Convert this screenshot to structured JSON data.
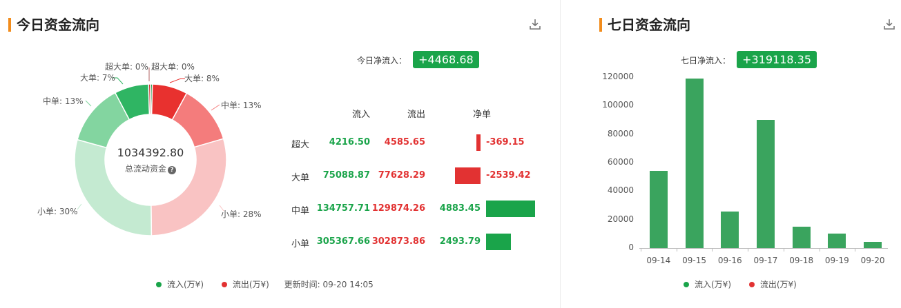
{
  "left": {
    "title": "今日资金流向",
    "net_label": "今日净流入：",
    "net_value": "+4468.68",
    "donut": {
      "total": "1034392.80",
      "total_label": "总流动资金",
      "segments": [
        {
          "label": "超大单: 0%",
          "pct": 0.4,
          "color": "#1f9a4a"
        },
        {
          "label": "大单: 8%",
          "pct": 7.5,
          "color": "#e8312f"
        },
        {
          "label": "中单: 13%",
          "pct": 12.6,
          "color": "#f47c7c"
        },
        {
          "label": "小单: 28%",
          "pct": 29.3,
          "color": "#f9c3c3"
        },
        {
          "label": "小单: 30%",
          "pct": 29.5,
          "color": "#c4ead1"
        },
        {
          "label": "中单: 13%",
          "pct": 13.0,
          "color": "#83d5a0"
        },
        {
          "label": "大单: 7%",
          "pct": 7.3,
          "color": "#2fb563"
        },
        {
          "label": "超大单: 0%",
          "pct": 0.4,
          "color": "#cf2b2b"
        }
      ]
    },
    "table": {
      "headers": [
        "流入",
        "流出",
        "净单"
      ],
      "rows": [
        {
          "name": "超大",
          "in": "4216.50",
          "out": "4585.65",
          "net": "-369.15",
          "net_value": -369.15
        },
        {
          "name": "大单",
          "in": "75088.87",
          "out": "77628.29",
          "net": "-2539.42",
          "net_value": -2539.42
        },
        {
          "name": "中单",
          "in": "134757.71",
          "out": "129874.26",
          "net": "4883.45",
          "net_value": 4883.45
        },
        {
          "name": "小单",
          "in": "305367.66",
          "out": "302873.86",
          "net": "2493.79",
          "net_value": 2493.79
        }
      ]
    },
    "legend": {
      "in": "流入(万¥)",
      "out": "流出(万¥)",
      "updated": "更新时间: 09-20 14:05"
    },
    "colors": {
      "green": "#1aa44a",
      "red": "#e23232",
      "accent": "#f28c1c"
    }
  },
  "right": {
    "title": "七日资金流向",
    "net_label": "七日净流入：",
    "net_value": "+319118.35",
    "legend": {
      "in": "流入(万¥)",
      "out": "流出(万¥)"
    }
  },
  "chart_data": {
    "type": "bar",
    "categories": [
      "09-14",
      "09-15",
      "09-16",
      "09-17",
      "09-18",
      "09-19",
      "09-20"
    ],
    "values": [
      54000,
      119000,
      25500,
      90000,
      14800,
      10200,
      4400
    ],
    "ylim": [
      0,
      120000
    ],
    "yticks": [
      "0",
      "20000",
      "40000",
      "60000",
      "80000",
      "100000",
      "120000"
    ],
    "grid": false,
    "title": "",
    "xlabel": "",
    "ylabel": ""
  }
}
